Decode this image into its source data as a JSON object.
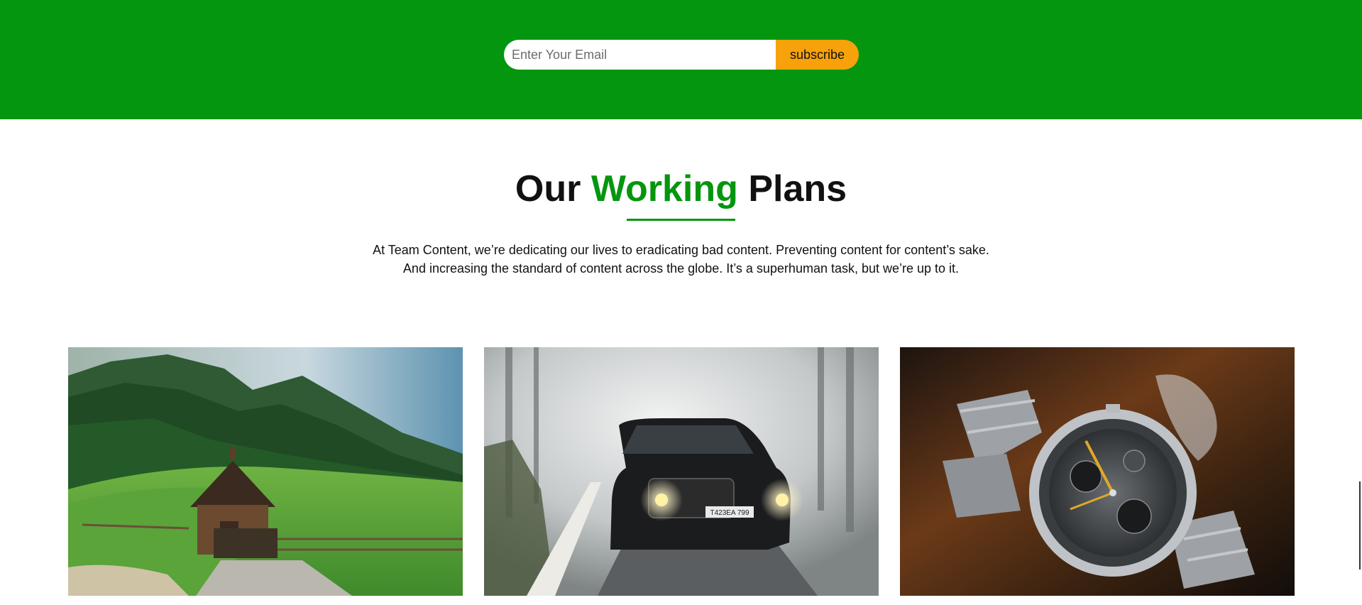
{
  "newsletter": {
    "email_placeholder": "Enter Your Email",
    "subscribe_label": "subscribe"
  },
  "section": {
    "title_part1": "Our ",
    "title_accent": "Working",
    "title_part2": " Plans",
    "description_line1": "At Team Content, we’re dedicating our lives to eradicating bad content. Preventing content for content’s sake.",
    "description_line2": "And increasing the standard of content across the globe. It’s a superhuman task, but we’re up to it."
  },
  "cards": [
    {
      "subject": "wooden-cabin-in-mountain-valley"
    },
    {
      "subject": "black-suv-on-foggy-forest-road",
      "plate": "T423EA 799"
    },
    {
      "subject": "steel-chronograph-wristwatch"
    }
  ],
  "colors": {
    "brand_green": "#04960e",
    "button_orange": "#f7a20a"
  }
}
